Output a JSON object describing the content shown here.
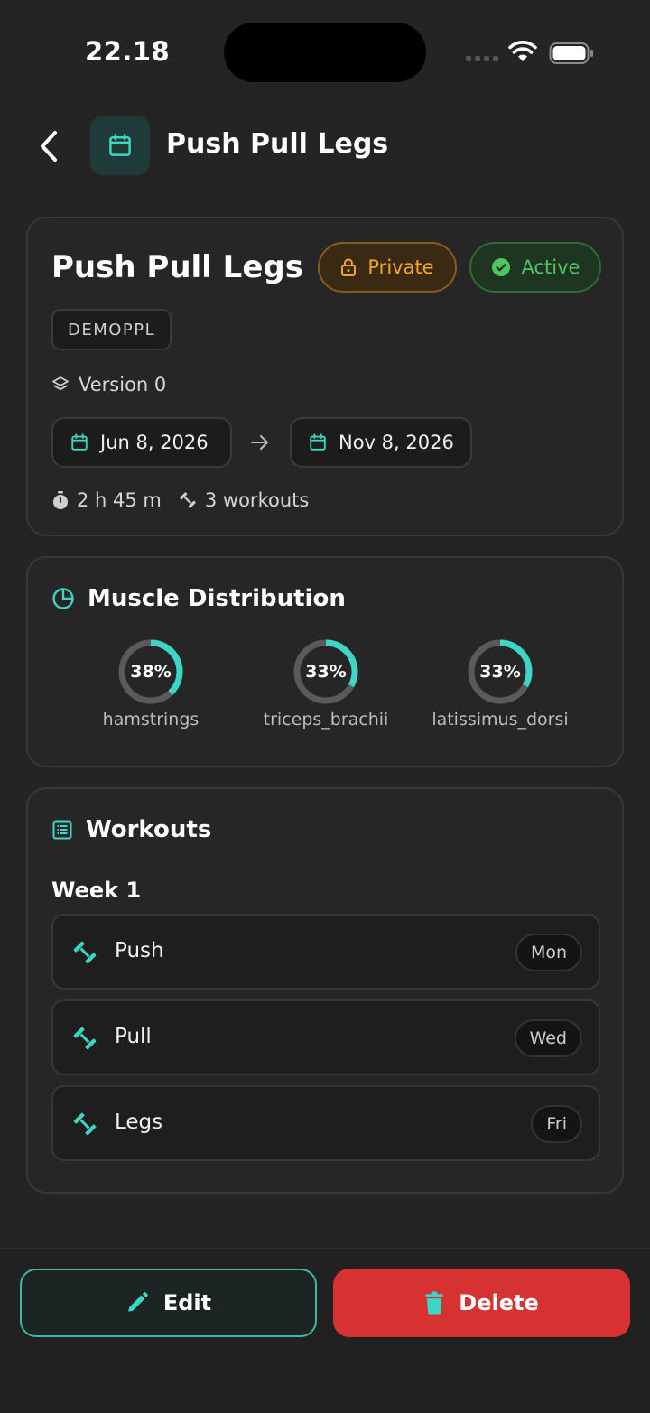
{
  "status_bar": {
    "time": "22.18"
  },
  "header": {
    "title": "Push Pull Legs",
    "back_icon": "chevron-left-icon",
    "icon": "calendar-icon"
  },
  "plan": {
    "name": "Push Pull Legs",
    "privacy_badge": "Private",
    "status_badge": "Active",
    "code": "DEMOPPL",
    "version": "Version 0",
    "start_date": "Jun 8, 2026",
    "end_date": "Nov 8, 2026",
    "duration": "2 h 45 m",
    "workout_count": "3 workouts"
  },
  "muscle_distribution": {
    "title": "Muscle Distribution",
    "items": [
      {
        "label": "hamstrings",
        "percent_text": "38%",
        "percent": 38
      },
      {
        "label": "triceps_brachii",
        "percent_text": "33%",
        "percent": 33
      },
      {
        "label": "latissimus_dorsi",
        "percent_text": "33%",
        "percent": 33
      }
    ]
  },
  "workouts": {
    "title": "Workouts",
    "week_label": "Week 1",
    "items": [
      {
        "name": "Push",
        "day": "Mon"
      },
      {
        "name": "Pull",
        "day": "Wed"
      },
      {
        "name": "Legs",
        "day": "Fri"
      }
    ]
  },
  "actions": {
    "edit_label": "Edit",
    "delete_label": "Delete"
  },
  "colors": {
    "accent": "#3dd6c6",
    "private": "#f5a623",
    "active": "#4ec55f",
    "danger": "#d63232",
    "background": "#242424"
  }
}
